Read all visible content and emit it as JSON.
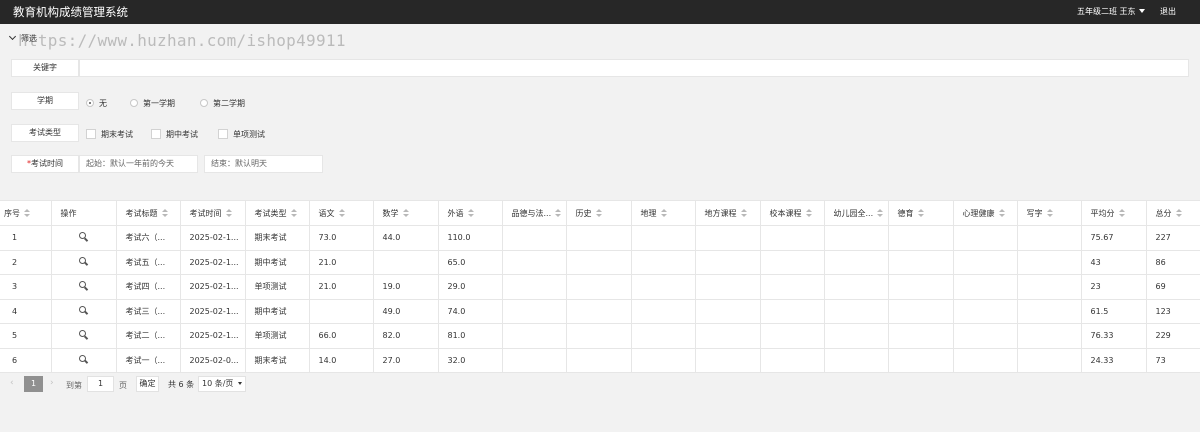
{
  "app": {
    "title": "教育机构成绩管理系统",
    "class_user": "五年级二班  王东",
    "logout": "退出"
  },
  "filter": {
    "toggle_label": "筛选",
    "watermark": "https://www.huzhan.com/ishop49911",
    "keyword_label": "关键字",
    "keyword_value": "",
    "semester_label": "学期",
    "semester_options": [
      "无",
      "第一学期",
      "第二学期"
    ],
    "semester_selected": "无",
    "exam_type_label": "考试类型",
    "exam_type_options": [
      "期末考试",
      "期中考试",
      "单项测试"
    ],
    "exam_time_required": "*",
    "exam_time_label": "考试时间",
    "start_placeholder": "起始：默认一年前的今天",
    "end_placeholder": "结束：默认明天"
  },
  "table": {
    "columns": [
      "序号",
      "操作",
      "考试标题",
      "考试时间",
      "考试类型",
      "语文",
      "数学",
      "外语",
      "品德与法...",
      "历史",
      "地理",
      "地方课程",
      "校本课程",
      "幼儿园全...",
      "德育",
      "心理健康",
      "写字",
      "平均分",
      "总分"
    ],
    "rows": [
      [
        "1",
        "",
        "考试六（...",
        "2025-02-1...",
        "期末考试",
        "73.0",
        "44.0",
        "110.0",
        "",
        "",
        "",
        "",
        "",
        "",
        "",
        "",
        "",
        "75.67",
        "227"
      ],
      [
        "2",
        "",
        "考试五（...",
        "2025-02-1...",
        "期中考试",
        "21.0",
        "",
        "65.0",
        "",
        "",
        "",
        "",
        "",
        "",
        "",
        "",
        "",
        "43",
        "86"
      ],
      [
        "3",
        "",
        "考试四（...",
        "2025-02-1...",
        "单项测试",
        "21.0",
        "19.0",
        "29.0",
        "",
        "",
        "",
        "",
        "",
        "",
        "",
        "",
        "",
        "23",
        "69"
      ],
      [
        "4",
        "",
        "考试三（...",
        "2025-02-1...",
        "期中考试",
        "",
        "49.0",
        "74.0",
        "",
        "",
        "",
        "",
        "",
        "",
        "",
        "",
        "",
        "61.5",
        "123"
      ],
      [
        "5",
        "",
        "考试二（...",
        "2025-02-1...",
        "单项测试",
        "66.0",
        "82.0",
        "81.0",
        "",
        "",
        "",
        "",
        "",
        "",
        "",
        "",
        "",
        "76.33",
        "229"
      ],
      [
        "6",
        "",
        "考试一（...",
        "2025-02-0...",
        "期末考试",
        "14.0",
        "27.0",
        "32.0",
        "",
        "",
        "",
        "",
        "",
        "",
        "",
        "",
        "",
        "24.33",
        "73"
      ]
    ]
  },
  "pager": {
    "prev": "‹",
    "current_page": "1",
    "next": "›",
    "goto_label": "到第",
    "page_input": "1",
    "page_unit": "页",
    "confirm": "确定",
    "total": "共 6 条",
    "page_size": "10 条/页"
  },
  "colors": {
    "topbar": "#272727",
    "page_bg": "#f2f2f2",
    "active_page": "#909090",
    "required": "#e02020"
  }
}
